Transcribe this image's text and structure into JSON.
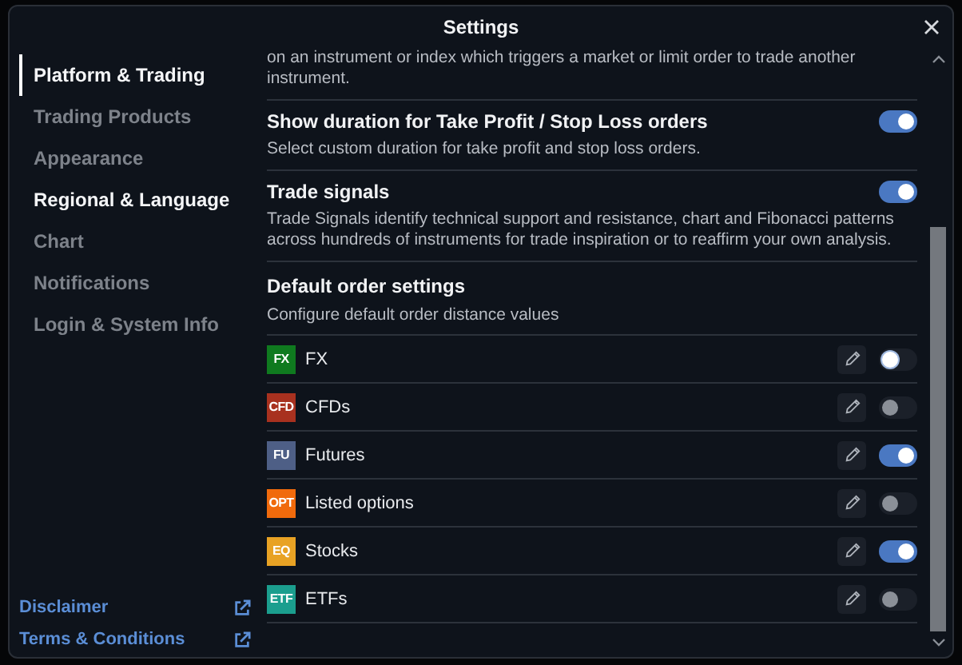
{
  "window": {
    "title": "Settings"
  },
  "sidebar": {
    "items": [
      {
        "label": "Platform & Trading",
        "selected": true,
        "muted": false
      },
      {
        "label": "Trading Products",
        "selected": false,
        "muted": true
      },
      {
        "label": "Appearance",
        "selected": false,
        "muted": true
      },
      {
        "label": "Regional & Language",
        "selected": false,
        "muted": false
      },
      {
        "label": "Chart",
        "selected": false,
        "muted": true
      },
      {
        "label": "Notifications",
        "selected": false,
        "muted": true
      },
      {
        "label": "Login & System Info",
        "selected": false,
        "muted": true
      }
    ],
    "links": [
      {
        "label": "Disclaimer"
      },
      {
        "label": "Terms & Conditions"
      }
    ]
  },
  "content": {
    "top_text": "on an instrument or index which triggers a market or limit order to trade another instrument.",
    "sections": [
      {
        "title": "Show duration for Take Profit / Stop Loss orders",
        "description": "Select custom duration for take profit and stop loss orders.",
        "on": true
      },
      {
        "title": "Trade signals",
        "description": "Trade Signals identify technical support and resistance, chart and Fibonacci patterns across hundreds of instruments for trade inspiration or to reaffirm your own analysis.",
        "on": true
      }
    ],
    "default_orders": {
      "title": "Default order settings",
      "description": "Configure default order distance values",
      "rows": [
        {
          "badge": "FX",
          "color": "#0f7a1f",
          "label": "FX",
          "on": false,
          "focused": true
        },
        {
          "badge": "CFD",
          "color": "#a8311f",
          "label": "CFDs",
          "on": false,
          "focused": false
        },
        {
          "badge": "FU",
          "color": "#4e5f86",
          "label": "Futures",
          "on": true,
          "focused": false
        },
        {
          "badge": "OPT",
          "color": "#f06a0c",
          "label": "Listed options",
          "on": false,
          "focused": false
        },
        {
          "badge": "EQ",
          "color": "#e8a224",
          "label": "Stocks",
          "on": true,
          "focused": false
        },
        {
          "badge": "ETF",
          "color": "#1b9e8e",
          "label": "ETFs",
          "on": false,
          "focused": false
        }
      ]
    }
  }
}
